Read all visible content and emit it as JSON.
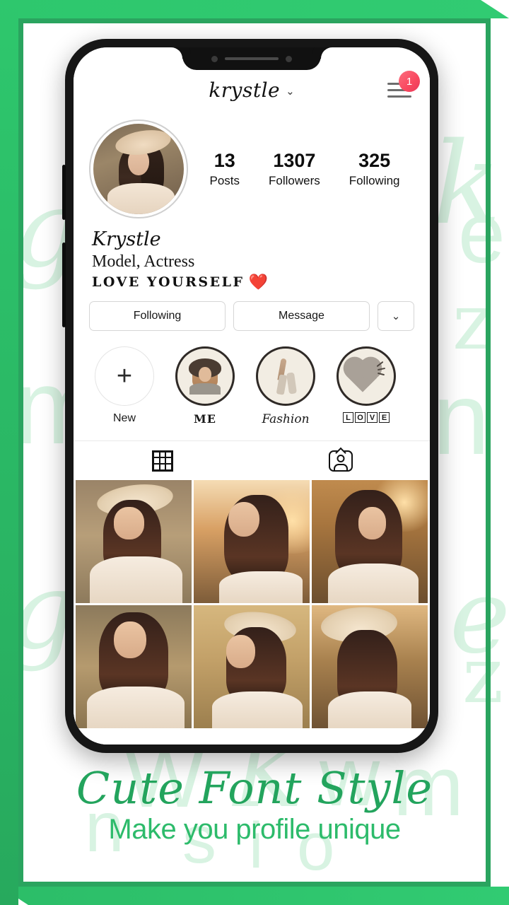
{
  "promo": {
    "headline": "Cute Font Style",
    "subhead": "Make you profile unique",
    "accent_green": "#2aa45f",
    "accent_green_light": "#31cb72",
    "watermark_letters": [
      "g",
      "k",
      "e",
      "z",
      "m",
      "n",
      "W",
      "K",
      "w",
      "m",
      "g",
      "e",
      "z",
      "n",
      "s",
      "i",
      "o"
    ]
  },
  "app": {
    "topbar": {
      "username": "krystle",
      "chevron": "⌄",
      "menu_icon": "hamburger-menu-icon",
      "badge_count": "1",
      "badge_color": "#f9485f"
    },
    "profile": {
      "avatar_alt": "profile-photo",
      "stats": [
        {
          "value": "13",
          "label": "Posts"
        },
        {
          "value": "1307",
          "label": "Followers"
        },
        {
          "value": "325",
          "label": "Following"
        }
      ],
      "bio": {
        "name": "Krystle",
        "role": "Model, Actress",
        "tagline": "LOVE YOURSELF",
        "tagline_emoji": "❤️"
      },
      "actions": [
        {
          "label": "Following",
          "type": "wide"
        },
        {
          "label": "Message",
          "type": "wide"
        },
        {
          "label": "⌄",
          "type": "square"
        }
      ]
    },
    "highlights": [
      {
        "label": "New",
        "icon": "plus-icon",
        "style": "new"
      },
      {
        "label": "ME",
        "icon": "person-portrait-icon",
        "style": "stamp"
      },
      {
        "label": "Fashion",
        "icon": "lipstick-icon",
        "style": "script"
      },
      {
        "label": "LOVE",
        "icon": "heart-icon",
        "style": "boxed"
      }
    ],
    "tabs": [
      {
        "name": "grid-tab",
        "icon": "grid-icon",
        "active": true
      },
      {
        "name": "tagged-tab",
        "icon": "tagged-person-icon",
        "active": false
      }
    ],
    "photos": [
      {
        "alt": "woman-in-hat-with-ukulele"
      },
      {
        "alt": "woman-smiling-at-sunset"
      },
      {
        "alt": "woman-touching-hair"
      },
      {
        "alt": "woman-portrait-field"
      },
      {
        "alt": "woman-in-hat-looking-away"
      },
      {
        "alt": "woman-back-view-with-hat"
      }
    ]
  }
}
